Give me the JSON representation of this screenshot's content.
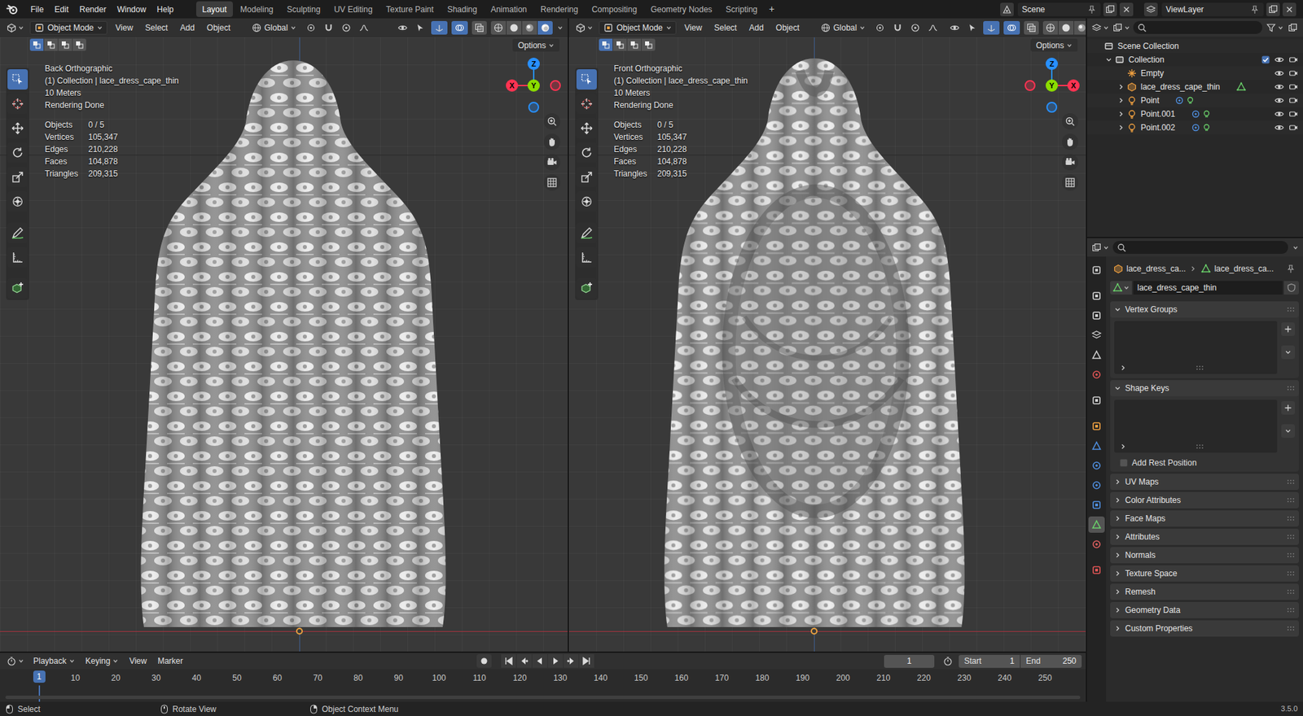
{
  "top_bar": {
    "menus": [
      "File",
      "Edit",
      "Render",
      "Window",
      "Help"
    ],
    "workspaces": [
      {
        "label": "Layout",
        "selected": true
      },
      {
        "label": "Modeling",
        "selected": false
      },
      {
        "label": "Sculpting",
        "selected": false
      },
      {
        "label": "UV Editing",
        "selected": false
      },
      {
        "label": "Texture Paint",
        "selected": false
      },
      {
        "label": "Shading",
        "selected": false
      },
      {
        "label": "Animation",
        "selected": false
      },
      {
        "label": "Rendering",
        "selected": false
      },
      {
        "label": "Compositing",
        "selected": false
      },
      {
        "label": "Geometry Nodes",
        "selected": false
      },
      {
        "label": "Scripting",
        "selected": false
      }
    ],
    "add_workspace": "+",
    "scene": "Scene",
    "view_layer": "ViewLayer"
  },
  "viewports": [
    {
      "kind": "back",
      "mode": "Object Mode",
      "menus": [
        "View",
        "Select",
        "Add",
        "Object"
      ],
      "orientation": "Global",
      "options": "Options",
      "view": "Back Orthographic",
      "collection": "(1) Collection | lace_dress_cape_thin",
      "scale": "10 Meters",
      "render_status": "Rendering Done",
      "stats": [
        {
          "label": "Objects",
          "value": "0 / 5"
        },
        {
          "label": "Vertices",
          "value": "105,347"
        },
        {
          "label": "Edges",
          "value": "210,228"
        },
        {
          "label": "Faces",
          "value": "104,878"
        },
        {
          "label": "Triangles",
          "value": "209,315"
        }
      ],
      "gizmo": {
        "x": "X",
        "y": "Y",
        "z": "Z",
        "x_positive_side": "left"
      },
      "shading": [
        {
          "selected": false
        },
        {
          "selected": false
        },
        {
          "selected": false
        },
        {
          "selected": true
        }
      ],
      "tools": [
        {
          "kind": "select",
          "selected": true
        },
        {
          "kind": "cursor",
          "selected": false
        },
        {
          "kind": "move",
          "selected": false
        },
        {
          "kind": "rotate",
          "selected": false
        },
        {
          "kind": "scale",
          "selected": false
        },
        {
          "kind": "transform",
          "selected": false
        },
        {
          "kind": "annotate",
          "selected": false
        },
        {
          "kind": "measure",
          "selected": false
        },
        {
          "kind": "add_cube",
          "selected": false
        }
      ]
    },
    {
      "kind": "front",
      "mode": "Object Mode",
      "menus": [
        "View",
        "Select",
        "Add",
        "Object"
      ],
      "orientation": "Global",
      "options": "Options",
      "view": "Front Orthographic",
      "collection": "(1) Collection | lace_dress_cape_thin",
      "scale": "10 Meters",
      "render_status": "Rendering Done",
      "stats": [
        {
          "label": "Objects",
          "value": "0 / 5"
        },
        {
          "label": "Vertices",
          "value": "105,347"
        },
        {
          "label": "Edges",
          "value": "210,228"
        },
        {
          "label": "Faces",
          "value": "104,878"
        },
        {
          "label": "Triangles",
          "value": "209,315"
        }
      ],
      "gizmo": {
        "x": "X",
        "y": "Y",
        "z": "Z",
        "x_positive_side": "right"
      },
      "shading": [
        {
          "selected": false
        },
        {
          "selected": false
        },
        {
          "selected": false
        },
        {
          "selected": true
        }
      ],
      "tools": [
        {
          "kind": "select",
          "selected": true
        },
        {
          "kind": "cursor",
          "selected": false
        },
        {
          "kind": "move",
          "selected": false
        },
        {
          "kind": "rotate",
          "selected": false
        },
        {
          "kind": "scale",
          "selected": false
        },
        {
          "kind": "transform",
          "selected": false
        },
        {
          "kind": "annotate",
          "selected": false
        },
        {
          "kind": "measure",
          "selected": false
        },
        {
          "kind": "add_cube",
          "selected": false
        }
      ]
    }
  ],
  "outliner": {
    "root": {
      "label": "Scene Collection",
      "kind": "scene_collection",
      "children": [
        {
          "label": "Collection",
          "kind": "collection",
          "expandable": true,
          "expanded": true,
          "checked": true,
          "visible": true,
          "renderable": true,
          "children": [
            {
              "label": "Empty",
              "kind": "empty",
              "expandable": false,
              "expanded": false,
              "visible": true,
              "renderable": true
            },
            {
              "label": "lace_dress_cape_thin",
              "kind": "mesh",
              "expandable": true,
              "expanded": false,
              "visible": true,
              "renderable": true
            },
            {
              "label": "Point",
              "kind": "light",
              "expandable": true,
              "expanded": false,
              "visible": true,
              "renderable": true
            },
            {
              "label": "Point.001",
              "kind": "light",
              "expandable": true,
              "expanded": false,
              "visible": true,
              "renderable": true
            },
            {
              "label": "Point.002",
              "kind": "light",
              "expandable": true,
              "expanded": false,
              "visible": true,
              "renderable": true
            }
          ]
        }
      ]
    }
  },
  "properties": {
    "tabs": [
      {
        "kind": "tool",
        "selected": false
      },
      {
        "kind": "render",
        "selected": false
      },
      {
        "kind": "output",
        "selected": false
      },
      {
        "kind": "view_layer",
        "selected": false
      },
      {
        "kind": "scene",
        "selected": false
      },
      {
        "kind": "world",
        "selected": false
      },
      {
        "kind": "collection",
        "selected": false
      },
      {
        "kind": "object",
        "selected": false
      },
      {
        "kind": "modifiers",
        "selected": false
      },
      {
        "kind": "particles",
        "selected": false
      },
      {
        "kind": "physics",
        "selected": false
      },
      {
        "kind": "constraints",
        "selected": false
      },
      {
        "kind": "data",
        "selected": true
      },
      {
        "kind": "material",
        "selected": false
      },
      {
        "kind": "texture",
        "selected": false
      }
    ],
    "breadcrumb": [
      "lace_dress_ca...",
      "lace_dress_ca..."
    ],
    "name": "lace_dress_cape_thin",
    "panels": [
      {
        "label": "Vertex Groups",
        "kind": "list",
        "expanded": true
      },
      {
        "label": "Shape Keys",
        "kind": "list",
        "expanded": true,
        "option": {
          "label": "Add Rest Position",
          "checked": false
        }
      },
      {
        "label": "UV Maps",
        "kind": "plain",
        "expanded": false
      },
      {
        "label": "Color Attributes",
        "kind": "plain",
        "expanded": false
      },
      {
        "label": "Face Maps",
        "kind": "plain",
        "expanded": false
      },
      {
        "label": "Attributes",
        "kind": "plain",
        "expanded": false
      },
      {
        "label": "Normals",
        "kind": "plain",
        "expanded": false
      },
      {
        "label": "Texture Space",
        "kind": "plain",
        "expanded": false
      },
      {
        "label": "Remesh",
        "kind": "plain",
        "expanded": false
      },
      {
        "label": "Geometry Data",
        "kind": "plain",
        "expanded": false
      },
      {
        "label": "Custom Properties",
        "kind": "plain",
        "expanded": false
      }
    ]
  },
  "timeline": {
    "menus": [
      "Playback",
      "Keying",
      "View",
      "Marker"
    ],
    "current_frame": "1",
    "start_label": "Start",
    "start": "1",
    "end_label": "End",
    "end": "250",
    "playhead": "1",
    "ruler": [
      "10",
      "20",
      "30",
      "40",
      "50",
      "60",
      "70",
      "80",
      "90",
      "100",
      "110",
      "120",
      "130",
      "140",
      "150",
      "160",
      "170",
      "180",
      "190",
      "200",
      "210",
      "220",
      "230",
      "240",
      "250"
    ]
  },
  "status_bar": {
    "items": [
      {
        "label": "Select",
        "kind": "left"
      },
      {
        "label": "Rotate View",
        "kind": "middle"
      },
      {
        "label": "Object Context Menu",
        "kind": "right"
      }
    ],
    "version": "3.5.0"
  }
}
